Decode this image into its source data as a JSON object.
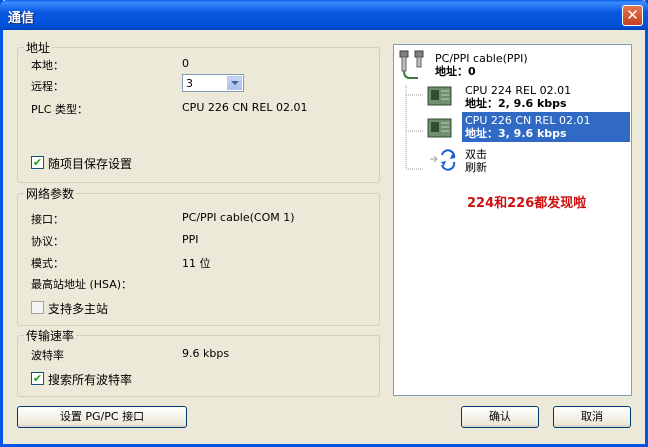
{
  "window": {
    "title": "通信"
  },
  "address_group": {
    "legend": "地址",
    "local_label": "本地：",
    "local_value": "0",
    "remote_label": "远程：",
    "remote_value": "3",
    "plc_type_label": "PLC 类型：",
    "plc_type_value": "CPU 226 CN REL 02.01",
    "save_label": "随项目保存设置",
    "save_checked": true
  },
  "network_group": {
    "legend": "网络参数",
    "interface_label": "接口：",
    "interface_value": "PC/PPI cable(COM 1)",
    "protocol_label": "协议：",
    "protocol_value": "PPI",
    "mode_label": "模式：",
    "mode_value": "11 位",
    "hsa_label": "最高站地址 (HSA)：",
    "hsa_value": "",
    "multimaster_label": "支持多主站",
    "multimaster_checked": false
  },
  "baud_group": {
    "legend": "传输速率",
    "baud_label": "波特率",
    "baud_value": "9.6 kbps",
    "search_label": "搜索所有波特率",
    "search_checked": true
  },
  "tree": {
    "root_line1": "PC/PPI cable(PPI)",
    "root_line2": "地址：0",
    "node1_line1": "CPU 224 REL 02.01",
    "node1_line2": "地址：2, 9.6 kbps",
    "node2_line1": "CPU 226 CN REL 02.01",
    "node2_line2": "地址：3, 9.6 kbps",
    "refresh_line1": "双击",
    "refresh_line2": "刷新",
    "annotation": "224和226都发现啦"
  },
  "buttons": {
    "setup_pgpc": "设置 PG/PC 接口",
    "ok": "确认",
    "cancel": "取消"
  },
  "colors": {
    "title_bar": "#0054e3",
    "selection": "#316ac5",
    "annotation": "#d01010"
  }
}
